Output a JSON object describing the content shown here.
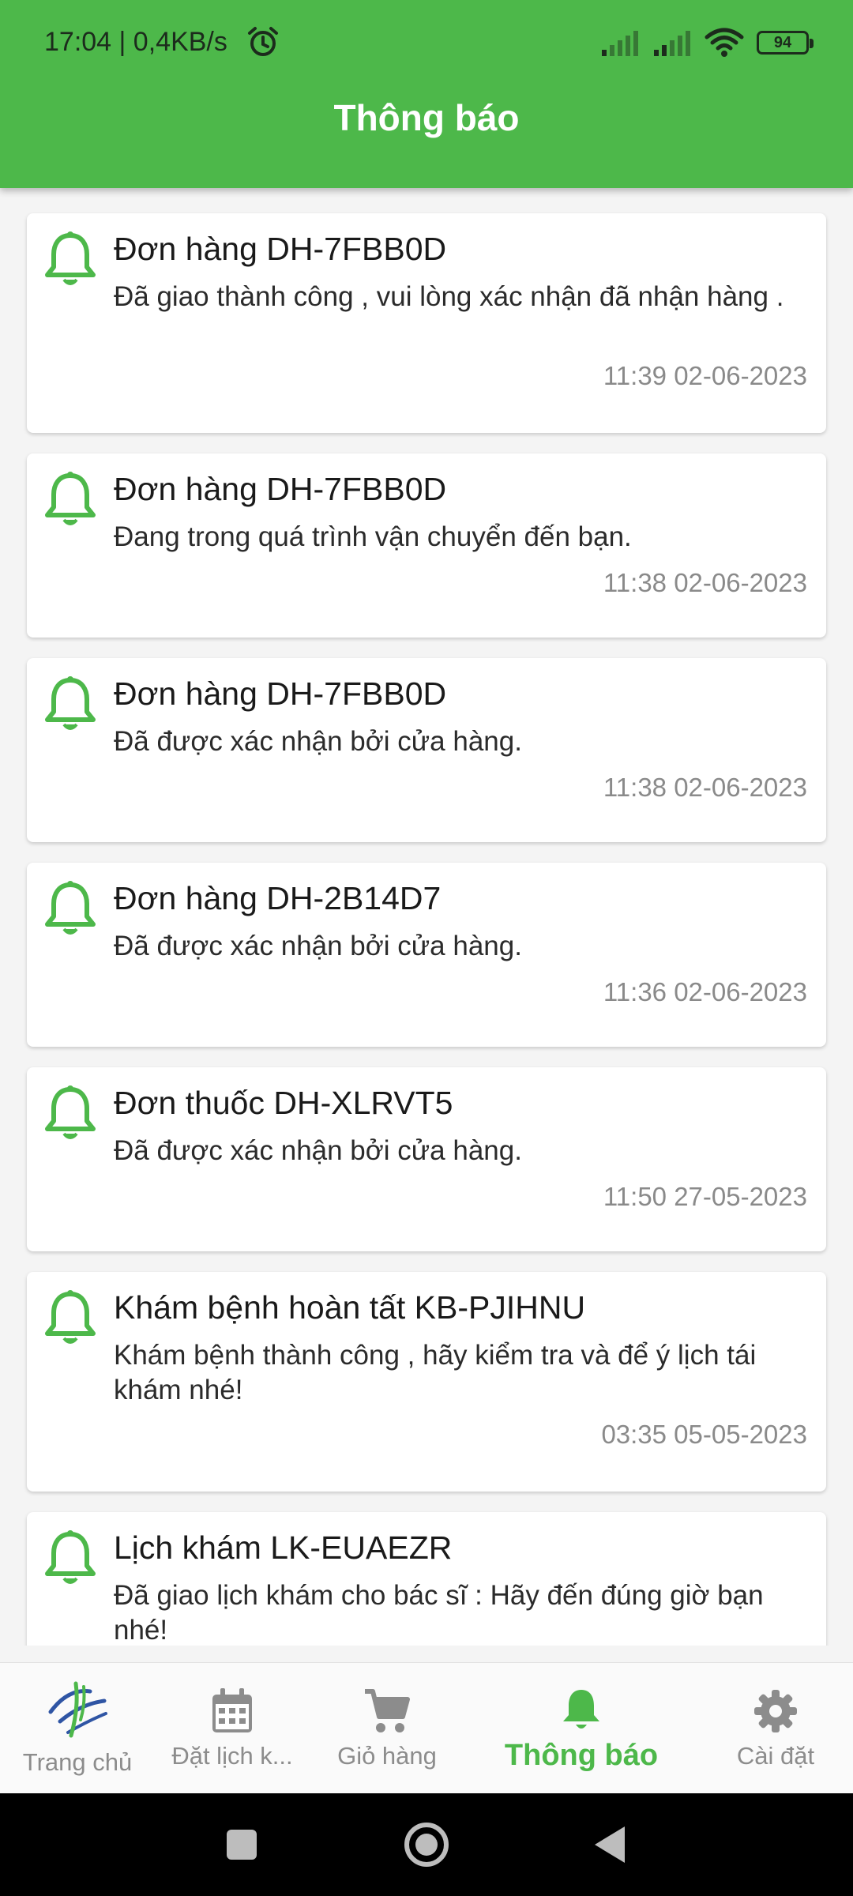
{
  "status_bar": {
    "time": "17:04 | 0,4KB/s",
    "battery": "94",
    "icons": [
      "alarm-icon",
      "signal-icon",
      "signal-icon",
      "wifi-icon",
      "battery-icon"
    ]
  },
  "header": {
    "title": "Thông báo"
  },
  "notifications": [
    {
      "title": "Đơn hàng DH-7FBB0D",
      "message": "Đã giao thành công , vui lòng xác nhận đã nhận hàng .",
      "time": "11:39 02-06-2023"
    },
    {
      "title": "Đơn hàng DH-7FBB0D",
      "message": "Đang trong quá trình vận chuyển đến bạn.",
      "time": "11:38 02-06-2023"
    },
    {
      "title": "Đơn hàng DH-7FBB0D",
      "message": "Đã được xác nhận bởi cửa hàng.",
      "time": "11:38 02-06-2023"
    },
    {
      "title": "Đơn hàng DH-2B14D7",
      "message": "Đã được xác nhận bởi cửa hàng.",
      "time": "11:36 02-06-2023"
    },
    {
      "title": "Đơn thuốc DH-XLRVT5",
      "message": "Đã được xác nhận bởi cửa hàng.",
      "time": "11:50 27-05-2023"
    },
    {
      "title": "Khám bệnh hoàn tất KB-PJIHNU",
      "message": "Khám bệnh thành công , hãy kiểm tra và để ý lịch tái khám nhé!",
      "time": "03:35 05-05-2023"
    },
    {
      "title": "Lịch khám LK-EUAEZR",
      "message": "Đã giao lịch khám cho bác sĩ : Hãy đến đúng giờ bạn nhé!",
      "time": ""
    }
  ],
  "bottom_nav": {
    "items": [
      {
        "label": "Trang chủ",
        "icon": "home-logo-icon"
      },
      {
        "label": "Đặt lịch k...",
        "icon": "calendar-icon"
      },
      {
        "label": "Giỏ hàng",
        "icon": "cart-icon"
      },
      {
        "label": "Thông báo",
        "icon": "bell-icon",
        "active": true
      },
      {
        "label": "Cài đặt",
        "icon": "gear-icon"
      }
    ]
  },
  "colors": {
    "primary": "#4db84a",
    "background": "#f4f4f4",
    "card": "#ffffff",
    "inactive": "#8c8c8c"
  }
}
